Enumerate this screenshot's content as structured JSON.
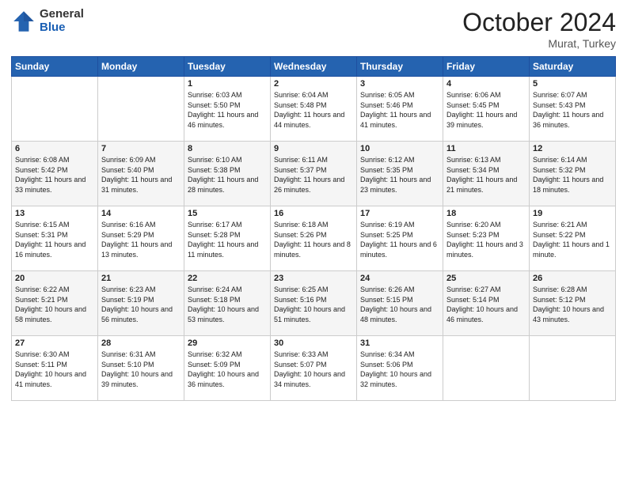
{
  "header": {
    "logo_general": "General",
    "logo_blue": "Blue",
    "title": "October 2024",
    "location": "Murat, Turkey"
  },
  "days_of_week": [
    "Sunday",
    "Monday",
    "Tuesday",
    "Wednesday",
    "Thursday",
    "Friday",
    "Saturday"
  ],
  "weeks": [
    [
      {
        "day": "",
        "sunrise": "",
        "sunset": "",
        "daylight": ""
      },
      {
        "day": "",
        "sunrise": "",
        "sunset": "",
        "daylight": ""
      },
      {
        "day": "1",
        "sunrise": "Sunrise: 6:03 AM",
        "sunset": "Sunset: 5:50 PM",
        "daylight": "Daylight: 11 hours and 46 minutes."
      },
      {
        "day": "2",
        "sunrise": "Sunrise: 6:04 AM",
        "sunset": "Sunset: 5:48 PM",
        "daylight": "Daylight: 11 hours and 44 minutes."
      },
      {
        "day": "3",
        "sunrise": "Sunrise: 6:05 AM",
        "sunset": "Sunset: 5:46 PM",
        "daylight": "Daylight: 11 hours and 41 minutes."
      },
      {
        "day": "4",
        "sunrise": "Sunrise: 6:06 AM",
        "sunset": "Sunset: 5:45 PM",
        "daylight": "Daylight: 11 hours and 39 minutes."
      },
      {
        "day": "5",
        "sunrise": "Sunrise: 6:07 AM",
        "sunset": "Sunset: 5:43 PM",
        "daylight": "Daylight: 11 hours and 36 minutes."
      }
    ],
    [
      {
        "day": "6",
        "sunrise": "Sunrise: 6:08 AM",
        "sunset": "Sunset: 5:42 PM",
        "daylight": "Daylight: 11 hours and 33 minutes."
      },
      {
        "day": "7",
        "sunrise": "Sunrise: 6:09 AM",
        "sunset": "Sunset: 5:40 PM",
        "daylight": "Daylight: 11 hours and 31 minutes."
      },
      {
        "day": "8",
        "sunrise": "Sunrise: 6:10 AM",
        "sunset": "Sunset: 5:38 PM",
        "daylight": "Daylight: 11 hours and 28 minutes."
      },
      {
        "day": "9",
        "sunrise": "Sunrise: 6:11 AM",
        "sunset": "Sunset: 5:37 PM",
        "daylight": "Daylight: 11 hours and 26 minutes."
      },
      {
        "day": "10",
        "sunrise": "Sunrise: 6:12 AM",
        "sunset": "Sunset: 5:35 PM",
        "daylight": "Daylight: 11 hours and 23 minutes."
      },
      {
        "day": "11",
        "sunrise": "Sunrise: 6:13 AM",
        "sunset": "Sunset: 5:34 PM",
        "daylight": "Daylight: 11 hours and 21 minutes."
      },
      {
        "day": "12",
        "sunrise": "Sunrise: 6:14 AM",
        "sunset": "Sunset: 5:32 PM",
        "daylight": "Daylight: 11 hours and 18 minutes."
      }
    ],
    [
      {
        "day": "13",
        "sunrise": "Sunrise: 6:15 AM",
        "sunset": "Sunset: 5:31 PM",
        "daylight": "Daylight: 11 hours and 16 minutes."
      },
      {
        "day": "14",
        "sunrise": "Sunrise: 6:16 AM",
        "sunset": "Sunset: 5:29 PM",
        "daylight": "Daylight: 11 hours and 13 minutes."
      },
      {
        "day": "15",
        "sunrise": "Sunrise: 6:17 AM",
        "sunset": "Sunset: 5:28 PM",
        "daylight": "Daylight: 11 hours and 11 minutes."
      },
      {
        "day": "16",
        "sunrise": "Sunrise: 6:18 AM",
        "sunset": "Sunset: 5:26 PM",
        "daylight": "Daylight: 11 hours and 8 minutes."
      },
      {
        "day": "17",
        "sunrise": "Sunrise: 6:19 AM",
        "sunset": "Sunset: 5:25 PM",
        "daylight": "Daylight: 11 hours and 6 minutes."
      },
      {
        "day": "18",
        "sunrise": "Sunrise: 6:20 AM",
        "sunset": "Sunset: 5:23 PM",
        "daylight": "Daylight: 11 hours and 3 minutes."
      },
      {
        "day": "19",
        "sunrise": "Sunrise: 6:21 AM",
        "sunset": "Sunset: 5:22 PM",
        "daylight": "Daylight: 11 hours and 1 minute."
      }
    ],
    [
      {
        "day": "20",
        "sunrise": "Sunrise: 6:22 AM",
        "sunset": "Sunset: 5:21 PM",
        "daylight": "Daylight: 10 hours and 58 minutes."
      },
      {
        "day": "21",
        "sunrise": "Sunrise: 6:23 AM",
        "sunset": "Sunset: 5:19 PM",
        "daylight": "Daylight: 10 hours and 56 minutes."
      },
      {
        "day": "22",
        "sunrise": "Sunrise: 6:24 AM",
        "sunset": "Sunset: 5:18 PM",
        "daylight": "Daylight: 10 hours and 53 minutes."
      },
      {
        "day": "23",
        "sunrise": "Sunrise: 6:25 AM",
        "sunset": "Sunset: 5:16 PM",
        "daylight": "Daylight: 10 hours and 51 minutes."
      },
      {
        "day": "24",
        "sunrise": "Sunrise: 6:26 AM",
        "sunset": "Sunset: 5:15 PM",
        "daylight": "Daylight: 10 hours and 48 minutes."
      },
      {
        "day": "25",
        "sunrise": "Sunrise: 6:27 AM",
        "sunset": "Sunset: 5:14 PM",
        "daylight": "Daylight: 10 hours and 46 minutes."
      },
      {
        "day": "26",
        "sunrise": "Sunrise: 6:28 AM",
        "sunset": "Sunset: 5:12 PM",
        "daylight": "Daylight: 10 hours and 43 minutes."
      }
    ],
    [
      {
        "day": "27",
        "sunrise": "Sunrise: 6:30 AM",
        "sunset": "Sunset: 5:11 PM",
        "daylight": "Daylight: 10 hours and 41 minutes."
      },
      {
        "day": "28",
        "sunrise": "Sunrise: 6:31 AM",
        "sunset": "Sunset: 5:10 PM",
        "daylight": "Daylight: 10 hours and 39 minutes."
      },
      {
        "day": "29",
        "sunrise": "Sunrise: 6:32 AM",
        "sunset": "Sunset: 5:09 PM",
        "daylight": "Daylight: 10 hours and 36 minutes."
      },
      {
        "day": "30",
        "sunrise": "Sunrise: 6:33 AM",
        "sunset": "Sunset: 5:07 PM",
        "daylight": "Daylight: 10 hours and 34 minutes."
      },
      {
        "day": "31",
        "sunrise": "Sunrise: 6:34 AM",
        "sunset": "Sunset: 5:06 PM",
        "daylight": "Daylight: 10 hours and 32 minutes."
      },
      {
        "day": "",
        "sunrise": "",
        "sunset": "",
        "daylight": ""
      },
      {
        "day": "",
        "sunrise": "",
        "sunset": "",
        "daylight": ""
      }
    ]
  ]
}
